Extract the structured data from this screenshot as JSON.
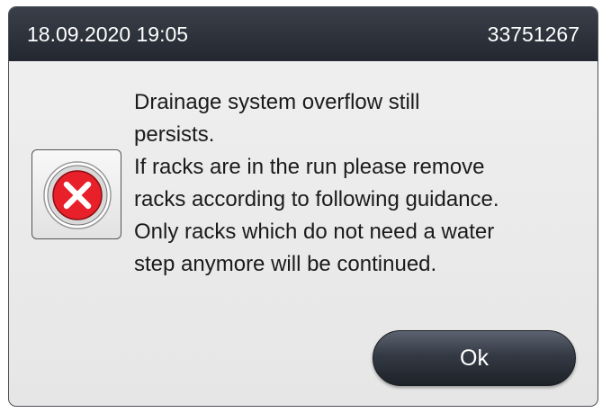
{
  "header": {
    "datetime": "18.09.2020 19:05",
    "message_code": "33751267"
  },
  "dialog": {
    "icon": "error-x-icon",
    "message_lines": [
      "Drainage system overflow still",
      "persists.",
      "If racks are in the run please remove",
      "racks according to following guidance.",
      "Only racks which do not need a water",
      "step anymore will be continued."
    ],
    "ok_label": "Ok"
  },
  "colors": {
    "titlebar": "#2b303a",
    "error_red": "#e8202a",
    "button_dark": "#343a44"
  }
}
